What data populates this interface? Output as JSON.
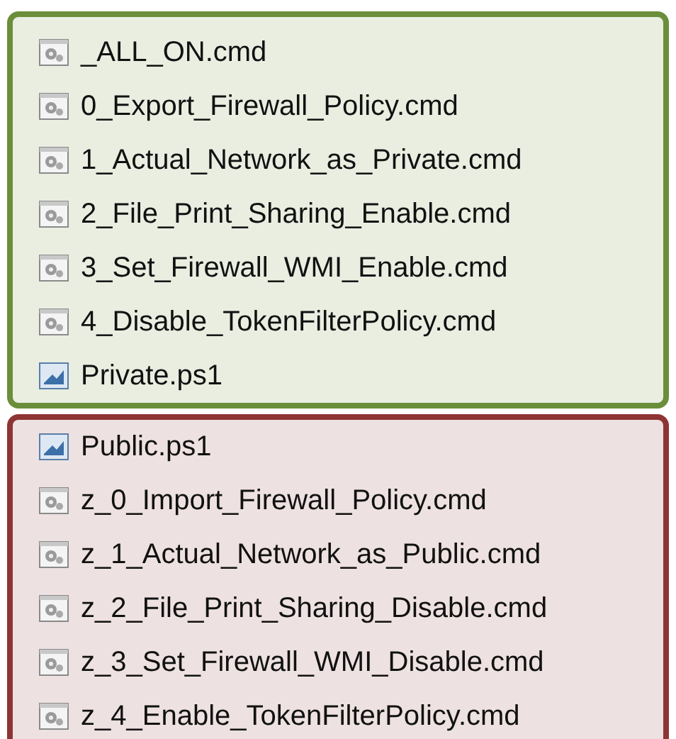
{
  "groups": [
    {
      "color": "#6b8e3a",
      "files": [
        {
          "name": "_ALL_ON.cmd",
          "kind": "cmd"
        },
        {
          "name": "0_Export_Firewall_Policy.cmd",
          "kind": "cmd"
        },
        {
          "name": "1_Actual_Network_as_Private.cmd",
          "kind": "cmd"
        },
        {
          "name": "2_File_Print_Sharing_Enable.cmd",
          "kind": "cmd"
        },
        {
          "name": "3_Set_Firewall_WMI_Enable.cmd",
          "kind": "cmd"
        },
        {
          "name": "4_Disable_TokenFilterPolicy.cmd",
          "kind": "cmd"
        },
        {
          "name": "Private.ps1",
          "kind": "ps1"
        }
      ]
    },
    {
      "color": "#8e3434",
      "files": [
        {
          "name": "Public.ps1",
          "kind": "ps1"
        },
        {
          "name": "z_0_Import_Firewall_Policy.cmd",
          "kind": "cmd"
        },
        {
          "name": "z_1_Actual_Network_as_Public.cmd",
          "kind": "cmd"
        },
        {
          "name": "z_2_File_Print_Sharing_Disable.cmd",
          "kind": "cmd"
        },
        {
          "name": "z_3_Set_Firewall_WMI_Disable.cmd",
          "kind": "cmd"
        },
        {
          "name": "z_4_Enable_TokenFilterPolicy.cmd",
          "kind": "cmd"
        }
      ]
    }
  ]
}
